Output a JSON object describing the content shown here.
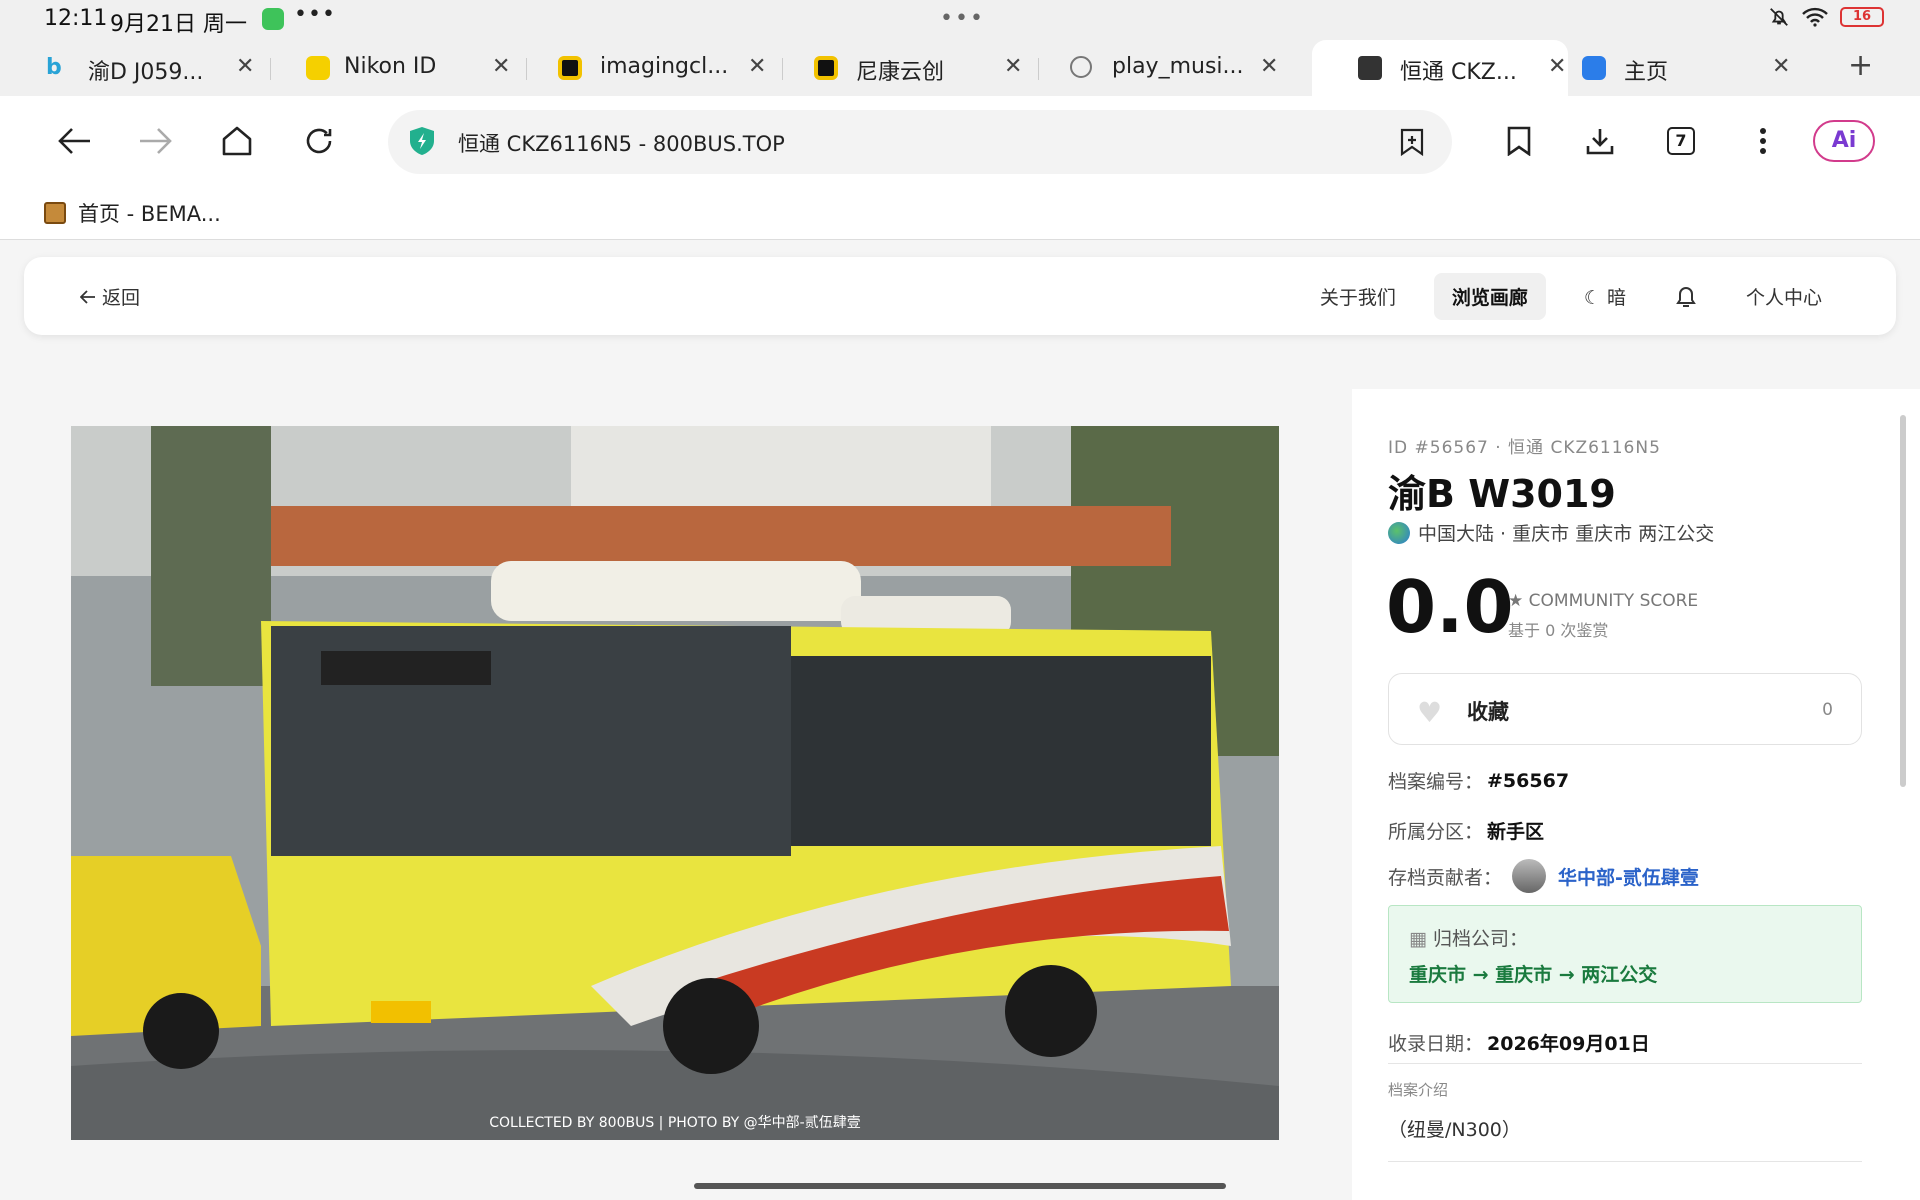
{
  "status": {
    "time": "12:11",
    "date": "9月21日 周一",
    "more": "•••",
    "battery": "16"
  },
  "tabs": [
    {
      "title": "渝D J059...",
      "icon": "bing-icon",
      "color": "#29a3d6"
    },
    {
      "title": "Nikon ID",
      "icon": "nikon-icon",
      "color": "#f5d000"
    },
    {
      "title": "imagingcl...",
      "icon": "imaging-cloud-icon",
      "color": "#f2c200"
    },
    {
      "title": "尼康云创",
      "icon": "nikon-cloud-icon",
      "color": "#f2c200"
    },
    {
      "title": "play_musi...",
      "icon": "planet-icon",
      "color": "#ffffff"
    },
    {
      "title": "恒通 CKZ...",
      "icon": "800bus-icon",
      "color": "#333333"
    },
    {
      "title": "主页",
      "icon": "home-tab-icon",
      "color": "#2b7de9"
    }
  ],
  "toolbar": {
    "url": "恒通 CKZ6116N5 - 800BUS.TOP",
    "tab_count": "7",
    "ai_label": "Ai"
  },
  "bookmarks": [
    {
      "label": "首页 - BEMA..."
    }
  ],
  "site_nav": {
    "back": "返回",
    "links": [
      "关于我们",
      "浏览画廊",
      "☾ 暗",
      "个人中心"
    ],
    "active": "浏览画廊"
  },
  "photo": {
    "credit": "COLLECTED BY 800BUS | PHOTO BY @华中部-贰伍肆壹"
  },
  "detail": {
    "id_line": "ID #56567 · 恒通 CKZ6116N5",
    "plate": "渝B W3019",
    "location": "中国大陆 · 重庆市 重庆市 两江公交",
    "score": "0.0",
    "score_label": "★ COMMUNITY SCORE",
    "score_sub": "基于 0 次鉴赏",
    "fav_label": "收藏",
    "fav_count": "0",
    "archive_no_label": "档案编号：",
    "archive_no": "#56567",
    "zone_label": "所属分区：",
    "zone": "新手区",
    "contributor_label": "存档贡献者：",
    "contributor": "华中部-贰伍肆壹",
    "company_label": "归档公司：",
    "company": "重庆市 → 重庆市 → 两江公交",
    "date_label": "收录日期：",
    "date": "2026年09月01日",
    "desc_label": "档案介绍",
    "desc": "（纽曼/N300）"
  }
}
